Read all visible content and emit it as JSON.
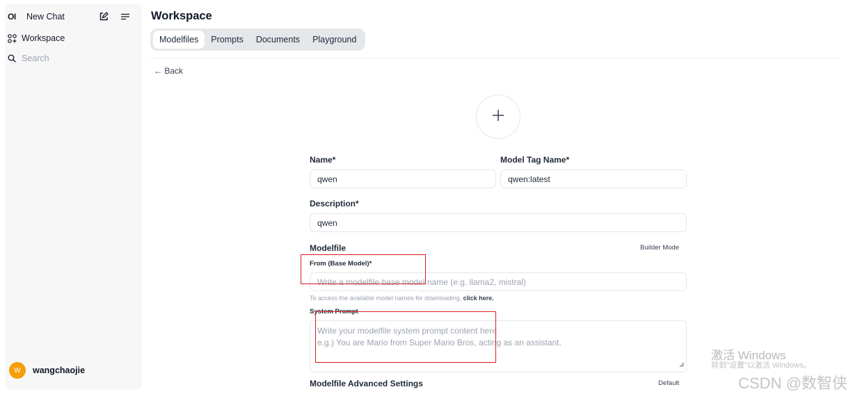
{
  "sidebar": {
    "logo": "OI",
    "new_chat": "New Chat",
    "workspace": "Workspace",
    "search_placeholder": "Search",
    "user": {
      "initial": "W",
      "name": "wangchaojie"
    }
  },
  "header": {
    "title": "Workspace",
    "tabs": [
      {
        "label": "Modelfiles",
        "active": true
      },
      {
        "label": "Prompts"
      },
      {
        "label": "Documents"
      },
      {
        "label": "Playground"
      }
    ]
  },
  "back": "← Back",
  "form": {
    "name_label": "Name*",
    "name_value": "qwen",
    "tag_label": "Model Tag Name*",
    "tag_value": "qwen:latest",
    "description_label": "Description*",
    "description_value": "qwen",
    "modelfile_label": "Modelfile",
    "builder_mode": "Builder Mode",
    "from_label": "From (Base Model)*",
    "from_placeholder": "Write a modelfile base model name (e.g. llama2, mistral)",
    "hint_text": "To access the available model names for downloading,",
    "hint_link": "click here.",
    "system_prompt_label": "System Prompt",
    "system_prompt_placeholder_1": "Write your modelfile system prompt content here",
    "system_prompt_placeholder_2": "e.g.) You are Mario from Super Mario Bros, acting as an assistant.",
    "advanced_label": "Modelfile Advanced Settings",
    "advanced_value": "Default"
  },
  "watermarks": {
    "activate_title": "激活 Windows",
    "activate_sub": "转到\"设置\"以激活 Windows。",
    "csdn": "CSDN @数智侠"
  },
  "colors": {
    "annotation": "#d71920",
    "avatar": "#f59e0b"
  },
  "icons": [
    "edit-icon",
    "menu-icon",
    "workspace-icon",
    "search-icon",
    "plus-icon",
    "resize-handle-icon"
  ]
}
